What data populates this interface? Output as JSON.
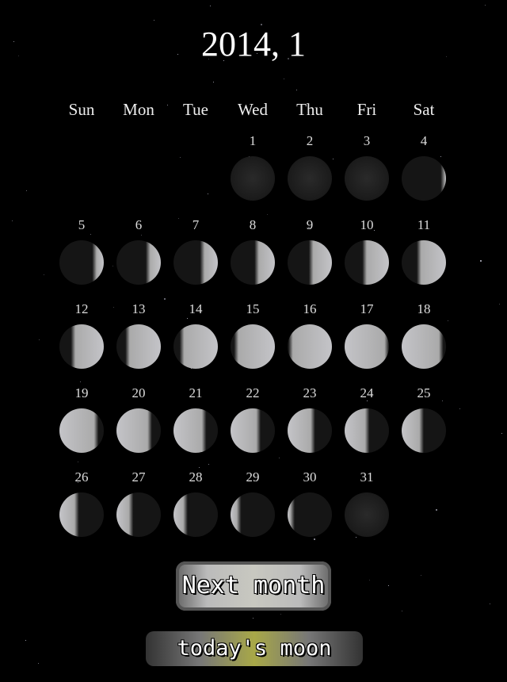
{
  "header": {
    "title": "2014, 1"
  },
  "weekdays": [
    "Sun",
    "Mon",
    "Tue",
    "Wed",
    "Thu",
    "Fri",
    "Sat"
  ],
  "calendar": {
    "year": 2014,
    "month": 1,
    "first_weekday_index": 3,
    "days": [
      {
        "day": "1",
        "phase": 0.97
      },
      {
        "day": "2",
        "phase": 0.0
      },
      {
        "day": "3",
        "phase": 0.03
      },
      {
        "day": "4",
        "phase": 0.06
      },
      {
        "day": "5",
        "phase": 0.13
      },
      {
        "day": "6",
        "phase": 0.17
      },
      {
        "day": "7",
        "phase": 0.2
      },
      {
        "day": "8",
        "phase": 0.23
      },
      {
        "day": "9",
        "phase": 0.26
      },
      {
        "day": "10",
        "phase": 0.3
      },
      {
        "day": "11",
        "phase": 0.33
      },
      {
        "day": "12",
        "phase": 0.37
      },
      {
        "day": "13",
        "phase": 0.4
      },
      {
        "day": "14",
        "phase": 0.43
      },
      {
        "day": "15",
        "phase": 0.46
      },
      {
        "day": "16",
        "phase": 0.49
      },
      {
        "day": "17",
        "phase": 0.5
      },
      {
        "day": "18",
        "phase": 0.53
      },
      {
        "day": "19",
        "phase": 0.56
      },
      {
        "day": "20",
        "phase": 0.6
      },
      {
        "day": "21",
        "phase": 0.63
      },
      {
        "day": "22",
        "phase": 0.66
      },
      {
        "day": "23",
        "phase": 0.69
      },
      {
        "day": "24",
        "phase": 0.72
      },
      {
        "day": "25",
        "phase": 0.75
      },
      {
        "day": "26",
        "phase": 0.78
      },
      {
        "day": "27",
        "phase": 0.81
      },
      {
        "day": "28",
        "phase": 0.84
      },
      {
        "day": "29",
        "phase": 0.88
      },
      {
        "day": "30",
        "phase": 0.92
      },
      {
        "day": "31",
        "phase": 0.95
      }
    ]
  },
  "buttons": {
    "next_month": "Next month",
    "todays_moon": "today's moon"
  },
  "colors": {
    "background": "#000000",
    "moon_light": "#c4c4c8",
    "moon_dark": "#1a1a1a"
  }
}
